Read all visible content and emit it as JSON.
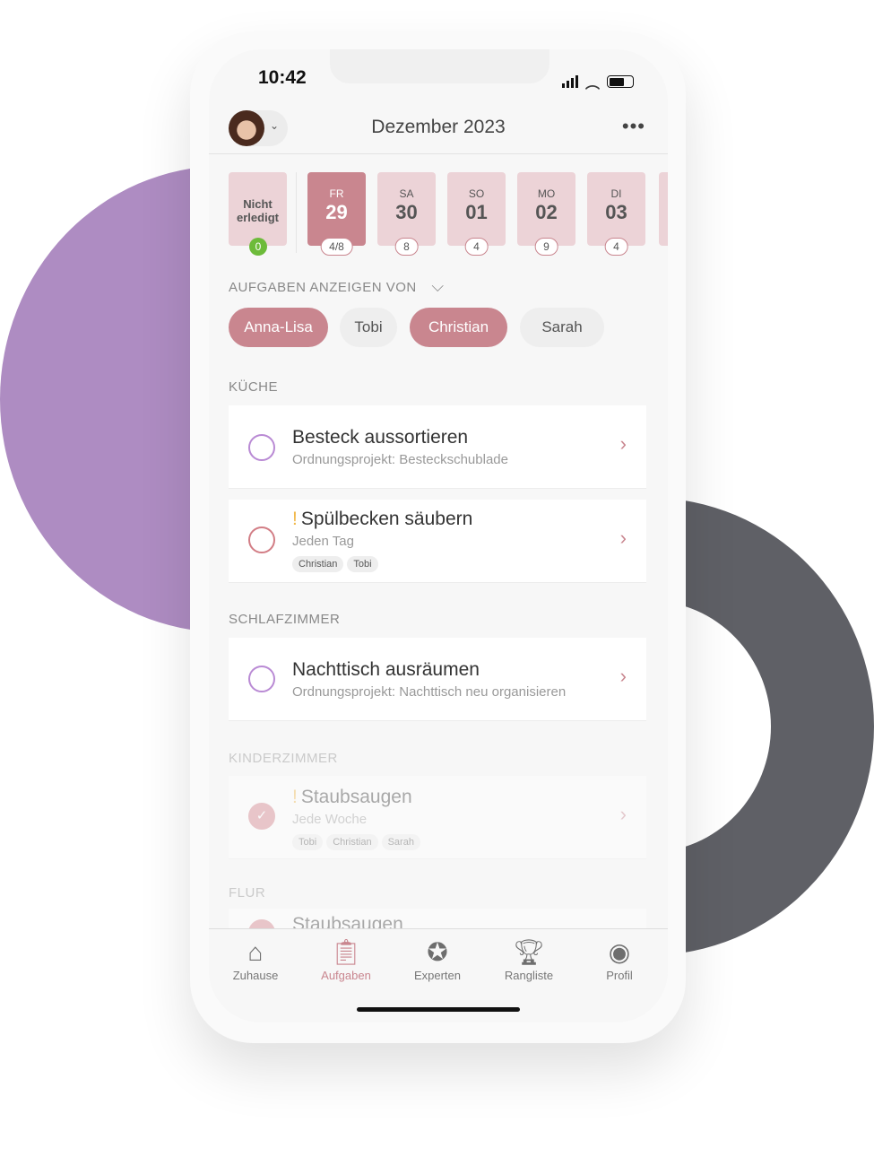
{
  "status": {
    "time": "10:42"
  },
  "header": {
    "title": "Dezember 2023",
    "more_icon": "ellipsis-icon"
  },
  "not_done": {
    "label_1": "Nicht",
    "label_2": "erledigt",
    "count": "0"
  },
  "days": [
    {
      "wd": "FR",
      "num": "29",
      "badge": "4/8",
      "selected": true
    },
    {
      "wd": "SA",
      "num": "30",
      "badge": "8"
    },
    {
      "wd": "SO",
      "num": "01",
      "badge": "4"
    },
    {
      "wd": "MO",
      "num": "02",
      "badge": "9"
    },
    {
      "wd": "DI",
      "num": "03",
      "badge": "4"
    }
  ],
  "filter": {
    "label": "AUFGABEN ANZEIGEN VON",
    "people": [
      "Anna-Lisa",
      "Tobi",
      "Christian",
      "Sarah"
    ]
  },
  "sections": {
    "kueche": "KÜCHE",
    "schlaf": "SCHLAFZIMMER",
    "kinder": "KINDERZIMMER",
    "flur": "FLUR"
  },
  "tasks": [
    {
      "title": "Besteck aussortieren",
      "sub": "Ordnungsprojekt: Besteckschublade"
    },
    {
      "title": "Spülbecken säubern",
      "sub": "Jeden Tag",
      "tags": [
        "Christian",
        "Tobi"
      ],
      "important": "!"
    },
    {
      "title": "Nachttisch ausräumen",
      "sub": "Ordnungsprojekt: Nachttisch neu organisieren"
    },
    {
      "title": "Staubsaugen",
      "sub": "Jede Woche",
      "tags": [
        "Tobi",
        "Christian",
        "Sarah"
      ],
      "important": "!",
      "done": true
    },
    {
      "title": "Staubsaugen"
    }
  ],
  "nav": [
    {
      "label": "Zuhause",
      "icon": "house-icon"
    },
    {
      "label": "Aufgaben",
      "icon": "clipboard-icon",
      "active": true
    },
    {
      "label": "Experten",
      "icon": "medal-icon"
    },
    {
      "label": "Rangliste",
      "icon": "trophy-icon"
    },
    {
      "label": "Profil",
      "icon": "person-icon"
    }
  ],
  "colors": {
    "accent": "#c9868f",
    "tile": "#ecd3d7",
    "purple": "#ae8cc2",
    "gray": "#5f6066",
    "green": "#6dbb3a"
  }
}
